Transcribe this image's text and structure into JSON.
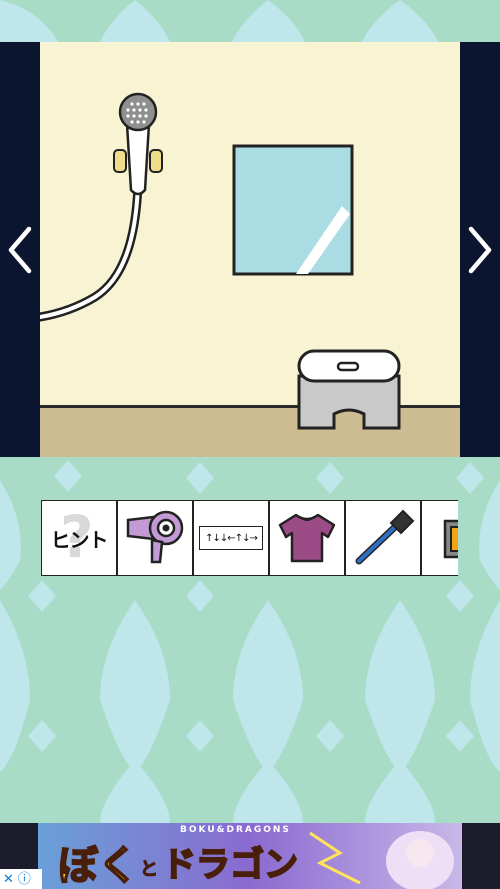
{
  "scene": {
    "objects": [
      "shower-head",
      "shower-hose",
      "mirror",
      "stool"
    ]
  },
  "navigation": {
    "left_icon": "chevron-left-icon",
    "right_icon": "chevron-right-icon"
  },
  "inventory": {
    "hint_label": "ヒント",
    "hint_mark": "?",
    "items": [
      {
        "name": "hint",
        "icon": "hint-icon"
      },
      {
        "name": "hair-dryer",
        "icon": "hair-dryer-icon"
      },
      {
        "name": "arrow-code-paper",
        "icon": "arrow-code-icon"
      },
      {
        "name": "t-shirt",
        "icon": "t-shirt-icon"
      },
      {
        "name": "toothbrush",
        "icon": "toothbrush-icon"
      },
      {
        "name": "box",
        "icon": "box-icon"
      }
    ],
    "arrow_code": "↑↓↓←↑↓→"
  },
  "ad": {
    "title_main": "ぼく",
    "title_small": "と",
    "title_right": "ドラゴン",
    "subtitle": "BOKU&DRAGONS",
    "close_symbol": "✕",
    "info_symbol": "ⓘ"
  },
  "colors": {
    "background": "#a8dcc6",
    "pattern": "#bfe6ea",
    "nav": "#0c1530",
    "wall": "#f8f3d3",
    "floor": "#cdbb92"
  }
}
